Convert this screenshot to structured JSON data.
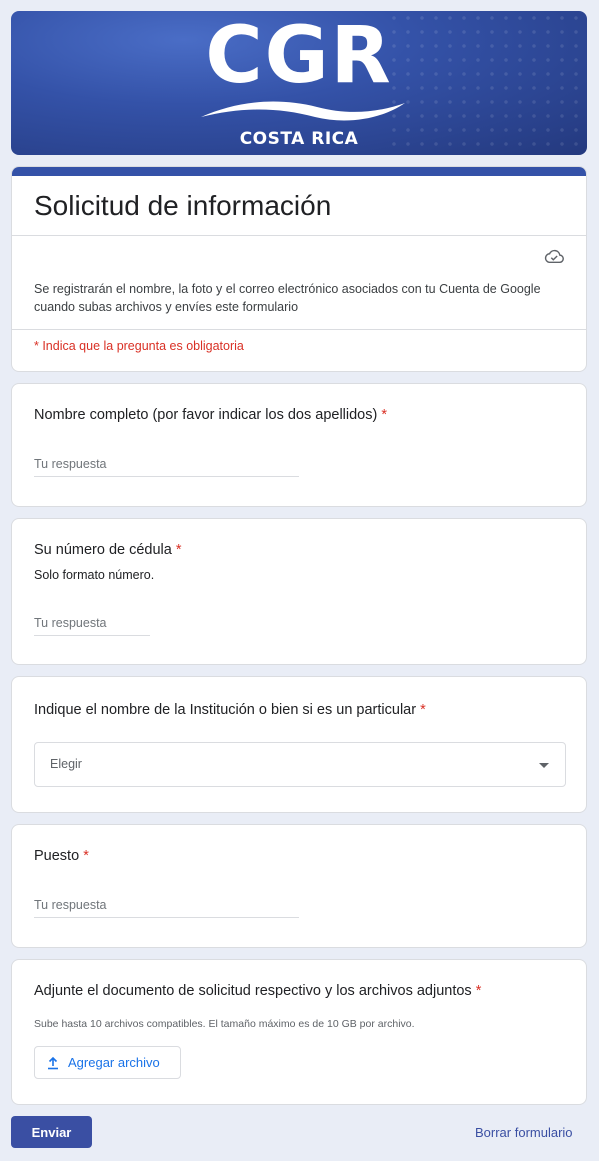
{
  "banner": {
    "logo_text": "CGR",
    "logo_subtext": "COSTA RICA"
  },
  "header": {
    "title": "Solicitud de información",
    "notice": "Se registrarán el nombre, la foto y el correo electrónico asociados con tu Cuenta de Google cuando subas archivos y envíes este formulario",
    "required_note": "* Indica que la pregunta es obligatoria",
    "save_status_icon": "cloud-check-icon"
  },
  "questions": [
    {
      "title": "Nombre completo (por favor indicar los dos apellidos)",
      "required_mark": "*",
      "placeholder": "Tu respuesta"
    },
    {
      "title": "Su número de cédula",
      "required_mark": "*",
      "description": "Solo formato número.",
      "placeholder": "Tu respuesta"
    },
    {
      "title": "Indique el nombre de la Institución o bien si es un particular",
      "required_mark": "*",
      "select_value": "Elegir"
    },
    {
      "title": "Puesto",
      "required_mark": "*",
      "placeholder": "Tu respuesta"
    },
    {
      "title": "Adjunte el documento de solicitud respectivo y los archivos adjuntos",
      "required_mark": "*",
      "hint": "Sube hasta 10 archivos compatibles. El tamaño máximo es de 10 GB por archivo.",
      "button_label": "Agregar archivo"
    }
  ],
  "footer": {
    "submit_label": "Enviar",
    "clear_label": "Borrar formulario"
  },
  "colors": {
    "accent": "#3a4fa3",
    "required": "#d93025",
    "link": "#1a73e8",
    "background": "#e9edf6"
  }
}
